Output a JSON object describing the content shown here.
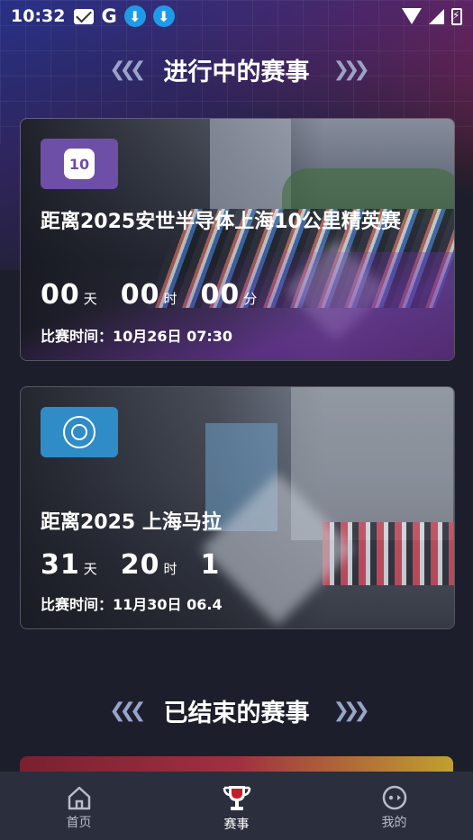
{
  "status_bar": {
    "time": "10:32",
    "google": "G"
  },
  "sections": {
    "ongoing_title": "进行中的赛事",
    "ended_title": "已结束的赛事"
  },
  "races": [
    {
      "title": "距离2025安世半导体上海10公里精英赛",
      "days": "00",
      "hours": "00",
      "minutes": "00",
      "day_unit": "天",
      "hour_unit": "时",
      "minute_unit": "分",
      "time_label": "比赛时间：10月26日 07:30",
      "badge_text": "10"
    },
    {
      "title": "距离2025 上海马拉",
      "days": "31",
      "hours": "20",
      "minutes": "1",
      "day_unit": "天",
      "hour_unit": "时",
      "time_label": "比赛时间：11月30日 06.4"
    }
  ],
  "tabbar": {
    "items": [
      {
        "label": "首页",
        "icon": "home-icon"
      },
      {
        "label": "赛事",
        "icon": "trophy-icon"
      },
      {
        "label": "我的",
        "icon": "profile-icon"
      }
    ],
    "active": "赛事"
  },
  "colors": {
    "background": "#1c1f2b",
    "tabbar": "#2b2e3c",
    "badge_purple": "#6d4fa8",
    "badge_blue": "#2f8cc6",
    "accent_red": "#c0202a"
  }
}
